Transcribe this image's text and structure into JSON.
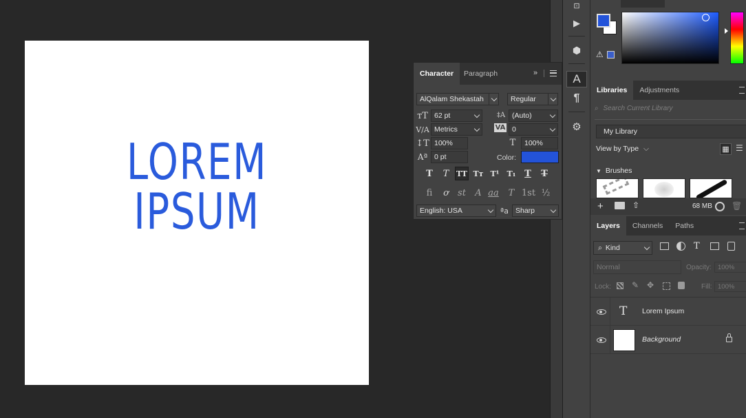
{
  "canvas": {
    "text": "LOREM IPSUM",
    "text_color": "#2a5bdc",
    "background": "#ffffff"
  },
  "character_panel": {
    "tabs": [
      "Character",
      "Paragraph"
    ],
    "font_family": "AlQalam Shekastah",
    "font_style": "Regular",
    "font_size": "62 pt",
    "leading": "(Auto)",
    "kerning": "Metrics",
    "tracking": "0",
    "vertical_scale": "100%",
    "horizontal_scale": "100%",
    "baseline_shift": "0 pt",
    "color_label": "Color:",
    "color_value": "#2353d9",
    "language": "English: USA",
    "antialias": "Sharp",
    "aa_icon": "ªa",
    "type_buttons": [
      "T",
      "T",
      "TT",
      "Tт",
      "T¹",
      "T₁",
      "T",
      "T"
    ],
    "opentype_buttons": [
      "fi",
      "ơ",
      "st",
      "A",
      "aa",
      "T",
      "1st",
      "½"
    ]
  },
  "color_panel": {
    "foreground": "#2353d9",
    "background": "#ffffff"
  },
  "libraries_panel": {
    "tabs": [
      "Libraries",
      "Adjustments"
    ],
    "search_placeholder": "Search Current Library",
    "library_name": "My Library",
    "view_by": "View by Type",
    "section": "Brushes",
    "storage": "68 MB"
  },
  "layers_panel": {
    "tabs": [
      "Layers",
      "Channels",
      "Paths"
    ],
    "filter": "Kind",
    "blend_mode": "Normal",
    "opacity_label": "Opacity:",
    "opacity_value": "100%",
    "lock_label": "Lock:",
    "fill_label": "Fill:",
    "fill_value": "100%",
    "layers": [
      {
        "name": "Lorem Ipsum",
        "type": "text"
      },
      {
        "name": "Background",
        "type": "image"
      }
    ]
  },
  "icons": [
    "play-icon",
    "3d-icon",
    "character-panel-icon",
    "paragraph-panel-icon",
    "properties-icon"
  ]
}
